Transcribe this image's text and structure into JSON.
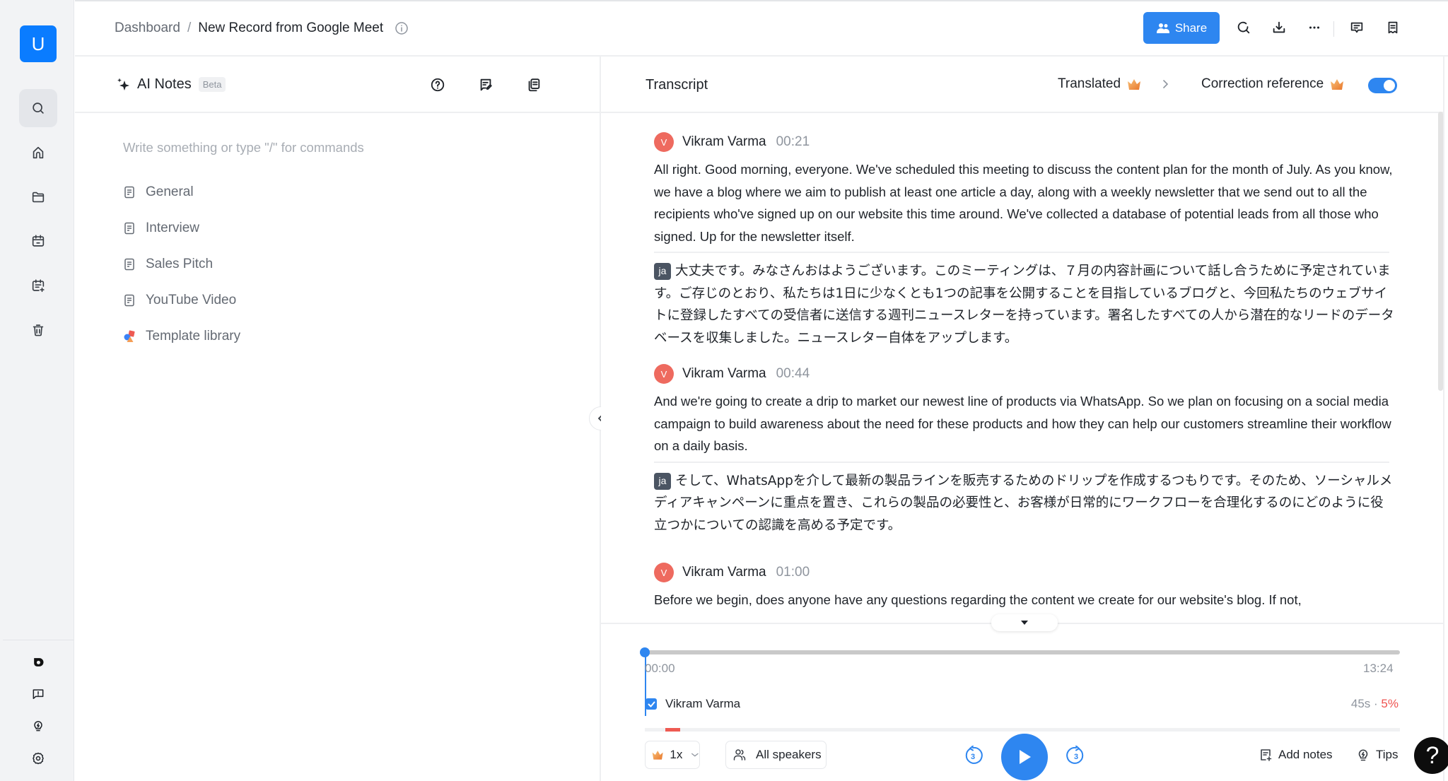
{
  "sidebar": {
    "logo_letter": "U",
    "nav_items": [
      {
        "name": "search",
        "icon": "search-icon",
        "active": true
      },
      {
        "name": "home",
        "icon": "home-icon",
        "active": false
      },
      {
        "name": "folder",
        "icon": "folder-icon",
        "active": false
      },
      {
        "name": "calendar",
        "icon": "calendar-icon",
        "active": false
      },
      {
        "name": "calendar-add",
        "icon": "calendar-add-icon",
        "active": false
      },
      {
        "name": "trash",
        "icon": "trash-icon",
        "active": false
      }
    ],
    "bottom_items": [
      {
        "name": "brand",
        "icon": "brand-logo-icon"
      },
      {
        "name": "feedback",
        "icon": "feedback-icon"
      },
      {
        "name": "tips",
        "icon": "lightbulb-icon"
      },
      {
        "name": "settings",
        "icon": "gear-icon"
      }
    ]
  },
  "header": {
    "breadcrumb_root": "Dashboard",
    "breadcrumb_sep": "/",
    "title": "New Record from Google Meet",
    "share_label": "Share",
    "colors": {
      "accent": "#2e86f0",
      "logo": "#0a7cff"
    }
  },
  "notes": {
    "title": "AI Notes",
    "badge": "Beta",
    "placeholder": "Write something or type \"/\" for commands",
    "templates": [
      {
        "label": "General",
        "icon": "document-icon"
      },
      {
        "label": "Interview",
        "icon": "document-icon"
      },
      {
        "label": "Sales Pitch",
        "icon": "document-icon"
      },
      {
        "label": "YouTube Video",
        "icon": "document-icon"
      },
      {
        "label": "Template library",
        "icon": "shapes-icon"
      }
    ]
  },
  "transcript": {
    "title": "Transcript",
    "translated_label": "Translated",
    "correction_label": "Correction reference",
    "correction_enabled": true,
    "segments": [
      {
        "avatar": "V",
        "speaker": "Vikram Varma",
        "time": "00:21",
        "text": "All right. Good morning, everyone. We've scheduled this meeting to discuss the content plan for the month of July. As you know, we have a blog where we aim to publish at least one article a day, along with a weekly newsletter that we send out to all the recipients who've signed up on our website this time around. We've collected a database of potential leads from all those who signed. Up for the newsletter itself.",
        "lang": "ja",
        "translation": "大丈夫です。みなさんおはようございます。このミーティングは、７月の内容計画について話し合うために予定されています。ご存じのとおり、私たちは1日に少なくとも1つの記事を公開することを目指しているブログと、今回私たちのウェブサイトに登録したすべての受信者に送信する週刊ニュースレターを持っています。署名したすべての人から潜在的なリードのデータベースを収集しました。ニュースレター自体をアップします。"
      },
      {
        "avatar": "V",
        "speaker": "Vikram Varma",
        "time": "00:44",
        "text": "And we're going to create a drip to market our newest line of products via WhatsApp. So we plan on focusing on a social media campaign to build awareness about the need for these products and how they can help our customers streamline their workflow on a daily basis.",
        "lang": "ja",
        "translation": "そして、WhatsAppを介して最新の製品ラインを販売するためのドリップを作成するつもりです。そのため、ソーシャルメディアキャンペーンに重点を置き、これらの製品の必要性と、お客様が日常的にワークフローを合理化するのにどのように役立つかについての認識を高める予定です。"
      },
      {
        "avatar": "V",
        "speaker": "Vikram Varma",
        "time": "01:00",
        "text": "Before we begin, does anyone have any questions regarding the content we create for our website's blog. If not,"
      }
    ]
  },
  "player": {
    "current_time": "00:00",
    "total_time": "13:24",
    "progress": 0.0,
    "speaker": {
      "name": "Vikram Varma",
      "checked": true,
      "duration": "45s",
      "separator": "·",
      "percent": "5%",
      "talk_segments": [
        [
          0.0275,
          0.0195
        ]
      ]
    },
    "speed": "1x",
    "speakers_filter": "All speakers",
    "rewind_seconds": "3",
    "forward_seconds": "3",
    "add_notes_label": "Add notes",
    "tips_label": "Tips",
    "help_label": "?"
  }
}
